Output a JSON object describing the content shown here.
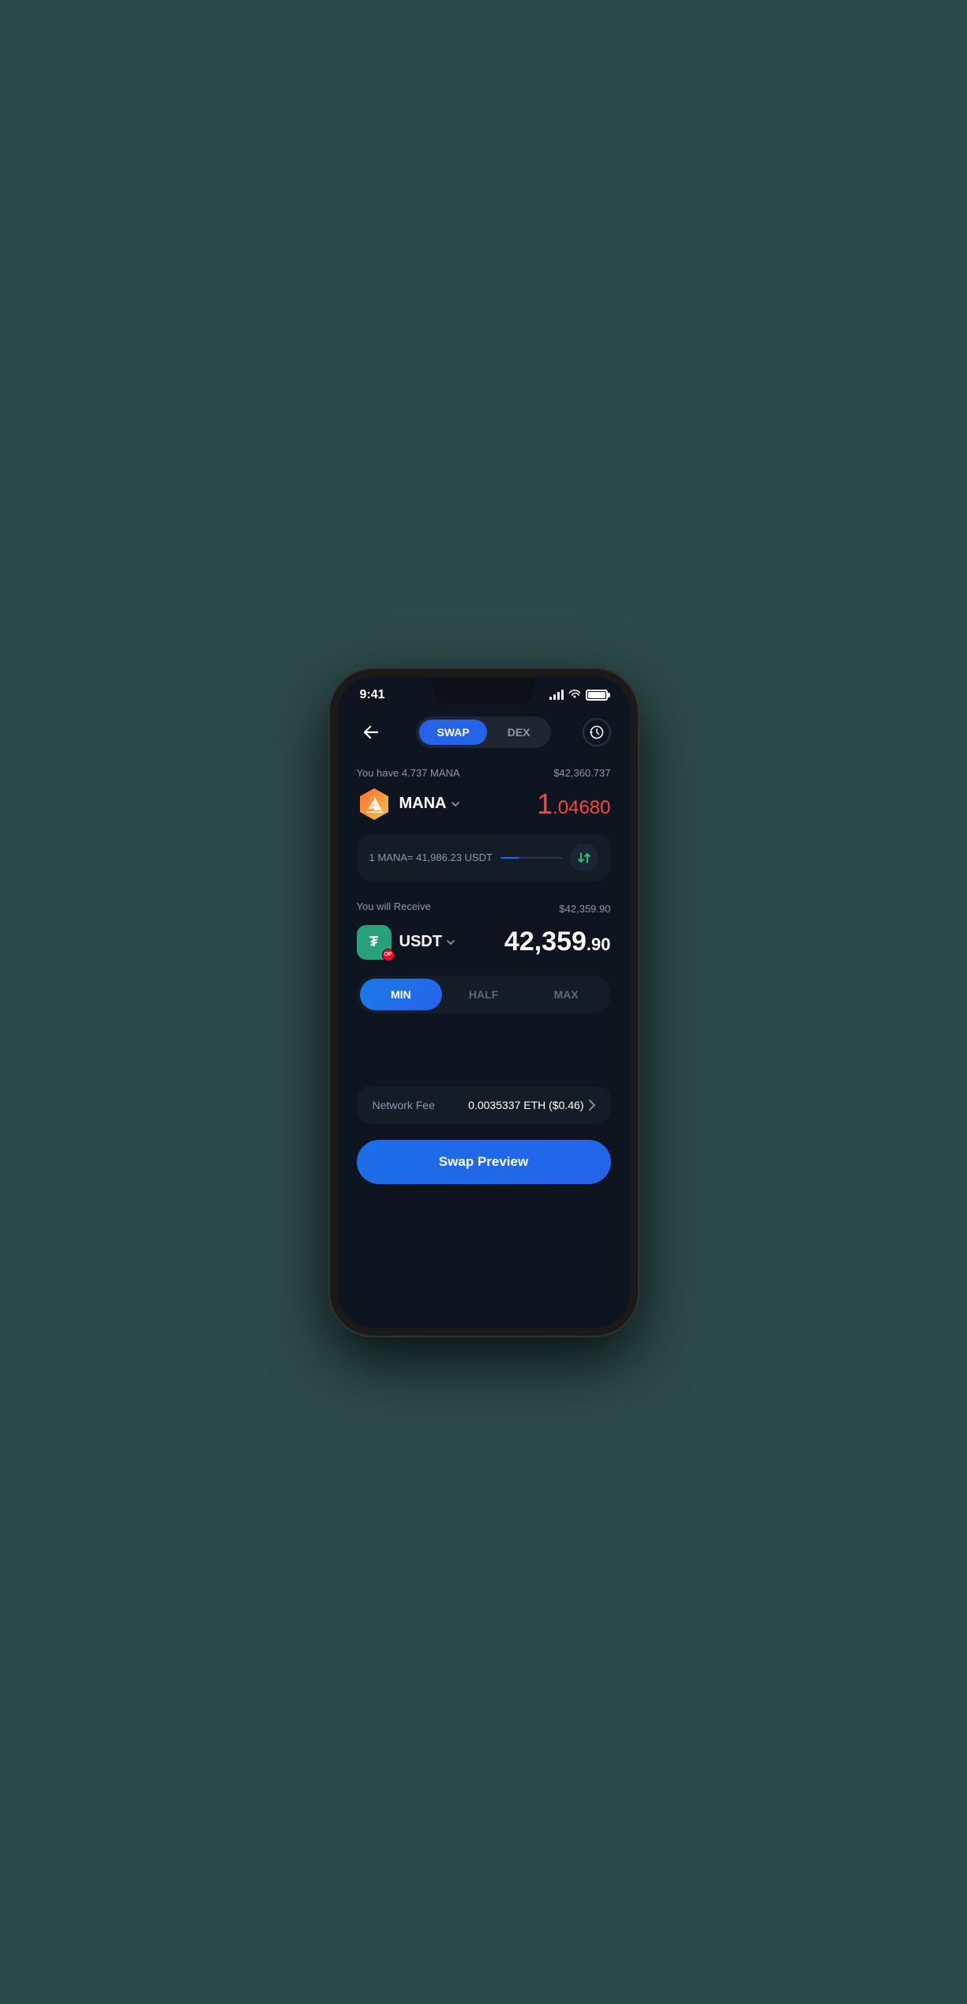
{
  "statusBar": {
    "time": "9:41"
  },
  "header": {
    "swapLabel": "SWAP",
    "dexLabel": "DEX",
    "activeTab": "swap"
  },
  "fromSection": {
    "balanceLabel": "You have 4.737 MANA",
    "balanceUsd": "$42,360.737",
    "tokenName": "MANA",
    "amount": "1",
    "amountDecimal": ".04680",
    "amountColor": "#ff4444"
  },
  "exchangeRate": {
    "text": "1 MANA= 41,986.23 USDT"
  },
  "receiveSection": {
    "label": "You will Receive",
    "usdValue": "$42,359.90",
    "tokenName": "USDT",
    "amountInteger": "42,359",
    "amountDecimal": ".90"
  },
  "amountSelector": {
    "minLabel": "MIN",
    "halfLabel": "HALF",
    "maxLabel": "MAX",
    "activeButton": "min"
  },
  "networkFee": {
    "label": "Network Fee",
    "value": "0.0035337 ETH ($0.46)"
  },
  "swapPreview": {
    "label": "Swap Preview"
  }
}
